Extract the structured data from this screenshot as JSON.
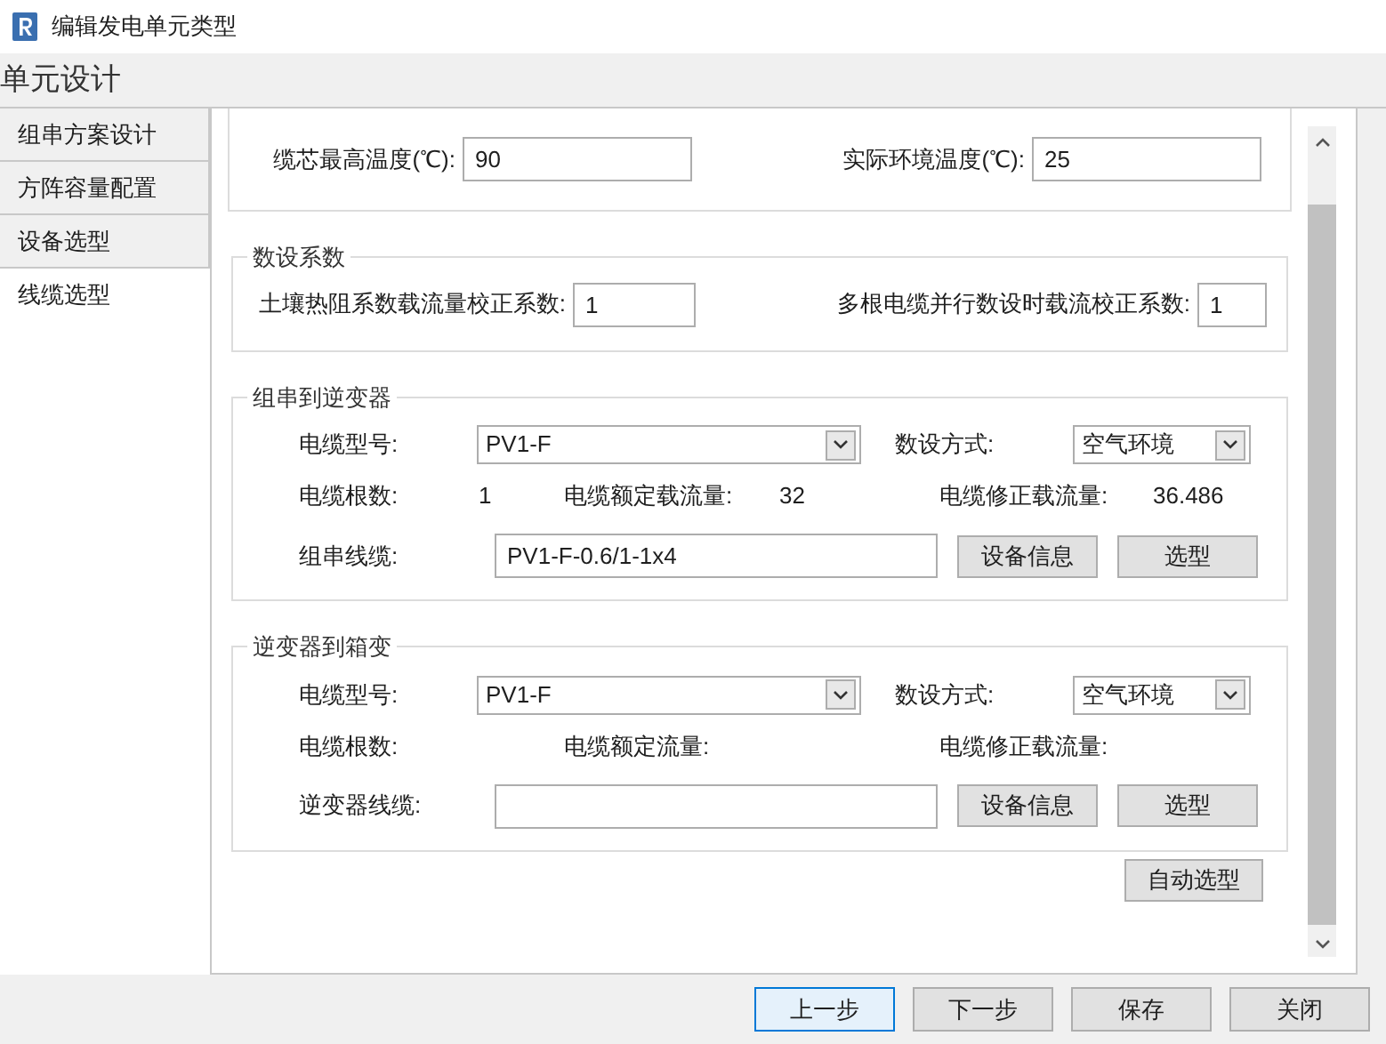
{
  "window": {
    "title": "编辑发电单元类型"
  },
  "header": "单元设计",
  "tabs": [
    {
      "label": "组串方案设计",
      "selected": false
    },
    {
      "label": "方阵容量配置",
      "selected": false
    },
    {
      "label": "设备选型",
      "selected": false
    },
    {
      "label": "线缆选型",
      "selected": true
    }
  ],
  "temperature": {
    "fields": [
      {
        "label": "缆芯最高温度(℃):",
        "value": "90"
      },
      {
        "label": "实际环境温度(℃):",
        "value": "25"
      }
    ]
  },
  "laying_coefficients": {
    "title": "数设系数",
    "fields": [
      {
        "label": "土壤热阻系数载流量校正系数:",
        "value": "1"
      },
      {
        "label": "多根电缆并行数设时载流校正系数:",
        "value": "1"
      }
    ]
  },
  "sections": [
    {
      "title": "组串到逆变器",
      "cable_model": {
        "label": "电缆型号:",
        "value": "PV1-F"
      },
      "laying_method": {
        "label": "数设方式:",
        "value": "空气环境"
      },
      "count": {
        "label": "电缆根数:",
        "value": "1"
      },
      "rated": {
        "label": "电缆额定载流量:",
        "value": "32"
      },
      "corrected": {
        "label": "电缆修正载流量:",
        "value": "36.486"
      },
      "cable": {
        "label": "组串线缆:",
        "value": "PV1-F-0.6/1-1x4"
      },
      "info_button": "设备信息",
      "select_button": "选型"
    },
    {
      "title": "逆变器到箱变",
      "cable_model": {
        "label": "电缆型号:",
        "value": "PV1-F"
      },
      "laying_method": {
        "label": "数设方式:",
        "value": "空气环境"
      },
      "count": {
        "label": "电缆根数:"
      },
      "rated": {
        "label": "电缆额定流量:"
      },
      "corrected": {
        "label": "电缆修正载流量:"
      },
      "cable": {
        "label": "逆变器线缆:"
      },
      "info_button": "设备信息",
      "select_button": "选型"
    }
  ],
  "auto_select_button": "自动选型",
  "buttons": [
    {
      "label": "上一步",
      "selected": true
    },
    {
      "label": "下一步",
      "selected": false
    },
    {
      "label": "保存",
      "selected": false
    },
    {
      "label": "关闭",
      "selected": false
    }
  ]
}
